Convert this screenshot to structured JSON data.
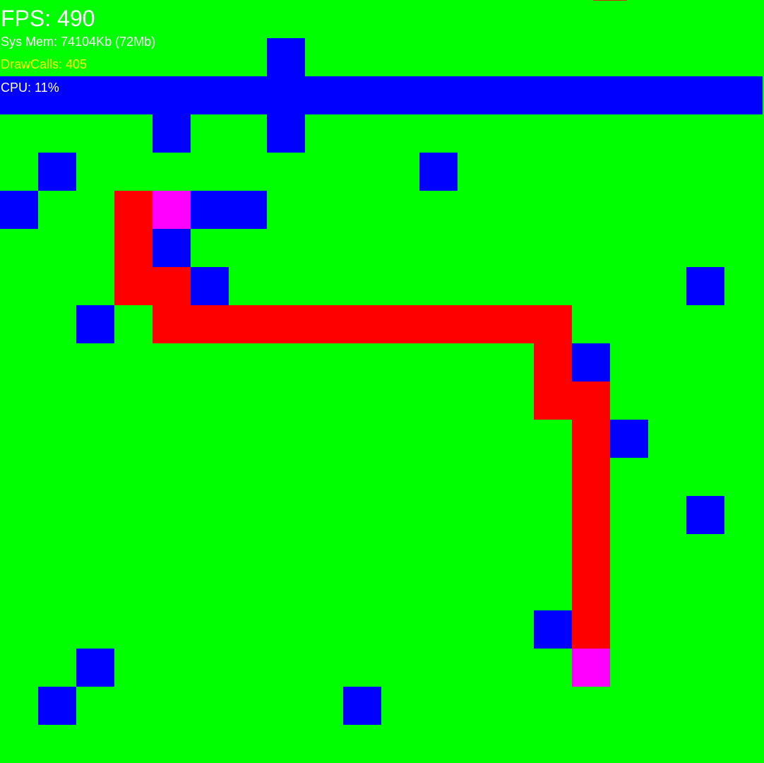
{
  "grid": {
    "cols": 20,
    "rows": 20,
    "colors": {
      "open": "#00ff00",
      "wall": "#0000ff",
      "path": "#ff0000",
      "endpoint": "#ff00ff"
    },
    "walls": [
      [
        7,
        1
      ],
      [
        0,
        2
      ],
      [
        1,
        2
      ],
      [
        2,
        2
      ],
      [
        3,
        2
      ],
      [
        4,
        2
      ],
      [
        5,
        2
      ],
      [
        6,
        2
      ],
      [
        7,
        2
      ],
      [
        8,
        2
      ],
      [
        9,
        2
      ],
      [
        10,
        2
      ],
      [
        11,
        2
      ],
      [
        12,
        2
      ],
      [
        13,
        2
      ],
      [
        14,
        2
      ],
      [
        15,
        2
      ],
      [
        16,
        2
      ],
      [
        17,
        2
      ],
      [
        18,
        2
      ],
      [
        19,
        2
      ],
      [
        4,
        3
      ],
      [
        7,
        3
      ],
      [
        1,
        4
      ],
      [
        11,
        4
      ],
      [
        0,
        5
      ],
      [
        5,
        5
      ],
      [
        6,
        5
      ],
      [
        4,
        6
      ],
      [
        5,
        7
      ],
      [
        18,
        7
      ],
      [
        2,
        8
      ],
      [
        15,
        9
      ],
      [
        16,
        11
      ],
      [
        18,
        13
      ],
      [
        14,
        16
      ],
      [
        2,
        17
      ],
      [
        1,
        18
      ],
      [
        9,
        18
      ]
    ],
    "path": [
      [
        3,
        5
      ],
      [
        3,
        6
      ],
      [
        3,
        7
      ],
      [
        4,
        7
      ],
      [
        4,
        8
      ],
      [
        5,
        8
      ],
      [
        6,
        8
      ],
      [
        7,
        8
      ],
      [
        8,
        8
      ],
      [
        9,
        8
      ],
      [
        10,
        8
      ],
      [
        11,
        8
      ],
      [
        12,
        8
      ],
      [
        13,
        8
      ],
      [
        14,
        8
      ],
      [
        14,
        9
      ],
      [
        14,
        10
      ],
      [
        15,
        10
      ],
      [
        15,
        11
      ],
      [
        15,
        12
      ],
      [
        15,
        13
      ],
      [
        15,
        14
      ],
      [
        15,
        15
      ],
      [
        15,
        16
      ]
    ],
    "endpoints": [
      {
        "role": "start",
        "cell": [
          4,
          5
        ]
      },
      {
        "role": "goal",
        "cell": [
          15,
          17
        ]
      }
    ]
  },
  "overlay": {
    "edge_color": "#00ff00",
    "top_mark_color": "#cc3300",
    "fps": {
      "text": "FPS: 490",
      "color": "#ffffff"
    },
    "sys_mem": {
      "text": "Sys Mem: 74104Kb (72Mb)",
      "color": "#ffffff"
    },
    "draw_calls": {
      "text": "DrawCalls: 405",
      "color": "#ffff00"
    },
    "cpu": {
      "text": "CPU: 11%",
      "color": "#ffffff"
    }
  }
}
